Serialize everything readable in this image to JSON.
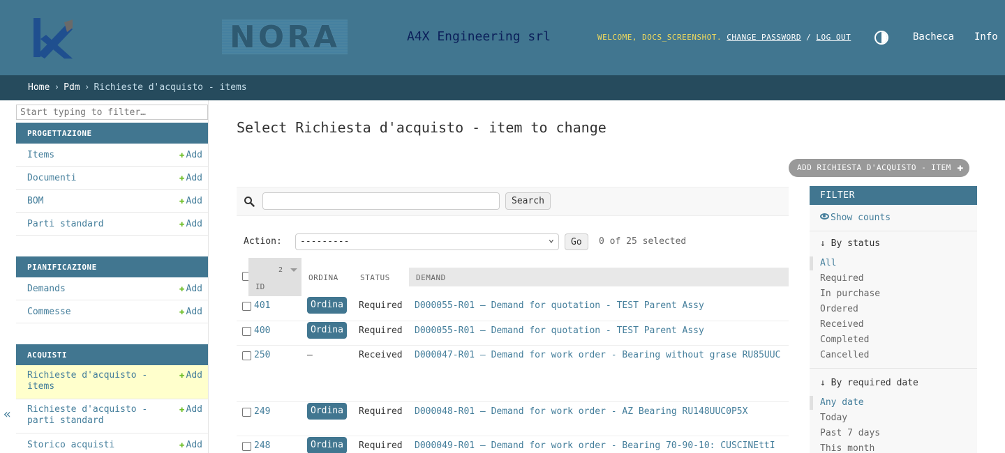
{
  "header": {
    "logo_text": "NORA",
    "company": "A4X Engineering srl",
    "welcome": "WELCOME, DOCS_SCREENSHOT.",
    "change_password": "CHANGE PASSWORD",
    "slash": "/",
    "log_out": "LOG OUT",
    "bacheca": "Bacheca",
    "info": "Info"
  },
  "breadcrumbs": {
    "home": "Home",
    "pdm": "Pdm",
    "current": "Richieste d'acquisto - items",
    "sep": "›"
  },
  "sidebar": {
    "filter_placeholder": "Start typing to filter…",
    "add_label": "Add",
    "collapse": "«",
    "modules": [
      {
        "title": "PROGETTAZIONE",
        "items": [
          "Items",
          "Documenti",
          "BOM",
          "Parti standard"
        ]
      },
      {
        "title": "PIANIFICAZIONE",
        "items": [
          "Demands",
          "Commesse"
        ]
      },
      {
        "title": "ACQUISTI",
        "items": [
          "Richieste d'acquisto - items",
          "Richieste d'acquisto - parti standard",
          "Storico acquisti"
        ]
      }
    ]
  },
  "content": {
    "title": "Select Richiesta d'acquisto - item to change",
    "add_button": "ADD RICHIESTA D'ACQUISTO - ITEM",
    "search_button": "Search",
    "action_label": "Action:",
    "action_value": "---------",
    "go_button": "Go",
    "selected": "0 of 25 selected"
  },
  "table": {
    "sort_priority": "2",
    "headers": {
      "id": "ID",
      "ordina": "ORDINA",
      "status": "STATUS",
      "demand": "DEMAND"
    },
    "ordina_label": "Ordina",
    "rows": [
      {
        "id": "401",
        "ordina": true,
        "status": "Required",
        "demand": "D000055-R01 — Demand for quotation - TEST Parent Assy"
      },
      {
        "id": "400",
        "ordina": true,
        "status": "Required",
        "demand": "D000055-R01 — Demand for quotation - TEST Parent Assy"
      },
      {
        "id": "250",
        "ordina": false,
        "dash": "—",
        "status": "Received",
        "demand": "D000047-R01 — Demand for work order - Bearing without grase RU85UUC"
      },
      {
        "id": "249",
        "ordina": true,
        "status": "Required",
        "demand": "D000048-R01 — Demand for work order - AZ Bearing RU148UUC0P5X"
      },
      {
        "id": "248",
        "ordina": true,
        "status": "Required",
        "demand": "D000049-R01 — Demand for work order - Bearing 70-90-10: CUSCINEttI"
      }
    ]
  },
  "filter": {
    "title": "FILTER",
    "show_counts": "Show counts",
    "by_status_title": "↓ By status",
    "status_options": [
      "All",
      "Required",
      "In purchase",
      "Ordered",
      "Received",
      "Completed",
      "Cancelled"
    ],
    "by_date_title": "↓ By required date",
    "date_options": [
      "Any date",
      "Today",
      "Past 7 days",
      "This month"
    ]
  },
  "colors": {
    "header_bg": "#417690",
    "breadcrumb_bg": "#264b5d",
    "accent_yellow": "#f5dd5d",
    "link": "#447e9b",
    "add_plus": "#70bf2b",
    "current_row": "#ffffcc"
  }
}
